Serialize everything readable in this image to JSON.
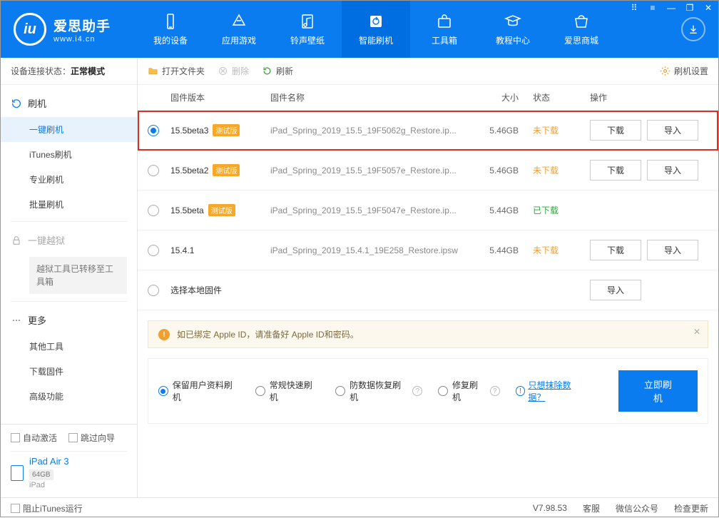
{
  "app": {
    "name": "爱思助手",
    "url": "www.i4.cn"
  },
  "nav": {
    "items": [
      {
        "label": "我的设备"
      },
      {
        "label": "应用游戏"
      },
      {
        "label": "铃声壁纸"
      },
      {
        "label": "智能刷机"
      },
      {
        "label": "工具箱"
      },
      {
        "label": "教程中心"
      },
      {
        "label": "爱思商城"
      }
    ],
    "active_index": 3
  },
  "sidebar": {
    "status_label": "设备连接状态：",
    "status_value": "正常模式",
    "flash": {
      "header": "刷机",
      "items": [
        "一键刷机",
        "iTunes刷机",
        "专业刷机",
        "批量刷机"
      ],
      "active_index": 0
    },
    "jailbreak": {
      "header": "一键越狱",
      "note": "越狱工具已转移至工具箱"
    },
    "more": {
      "header": "更多",
      "items": [
        "其他工具",
        "下载固件",
        "高级功能"
      ]
    },
    "checks": {
      "auto_activate": "自动激活",
      "skip_guide": "跳过向导"
    },
    "device": {
      "name": "iPad Air 3",
      "storage": "64GB",
      "type": "iPad"
    }
  },
  "toolbar": {
    "open_folder": "打开文件夹",
    "delete": "删除",
    "refresh": "刷新",
    "settings": "刷机设置"
  },
  "table": {
    "headers": {
      "version": "固件版本",
      "name": "固件名称",
      "size": "大小",
      "status": "状态",
      "ops": "操作"
    },
    "beta_tag": "测试版",
    "status_labels": {
      "not_downloaded": "未下载",
      "downloaded": "已下载"
    },
    "btn_download": "下载",
    "btn_import": "导入",
    "rows": [
      {
        "version": "15.5beta3",
        "beta": true,
        "name": "iPad_Spring_2019_15.5_19F5062g_Restore.ip...",
        "size": "5.46GB",
        "status": "not_downloaded",
        "selected": true,
        "highlight": true,
        "ops": [
          "download",
          "import"
        ]
      },
      {
        "version": "15.5beta2",
        "beta": true,
        "name": "iPad_Spring_2019_15.5_19F5057e_Restore.ip...",
        "size": "5.46GB",
        "status": "not_downloaded",
        "ops": [
          "download",
          "import"
        ]
      },
      {
        "version": "15.5beta",
        "beta": true,
        "name": "iPad_Spring_2019_15.5_19F5047e_Restore.ip...",
        "size": "5.44GB",
        "status": "downloaded",
        "ops": []
      },
      {
        "version": "15.4.1",
        "beta": false,
        "name": "iPad_Spring_2019_15.4.1_19E258_Restore.ipsw",
        "size": "5.44GB",
        "status": "not_downloaded",
        "ops": [
          "download",
          "import"
        ]
      }
    ],
    "local_row": "选择本地固件"
  },
  "notice": "如已绑定 Apple ID，请准备好 Apple ID和密码。",
  "options": {
    "items": [
      "保留用户资料刷机",
      "常规快速刷机",
      "防数据恢复刷机",
      "修复刷机"
    ],
    "selected_index": 0,
    "erase_link": "只想抹除数据？",
    "flash_btn": "立即刷机"
  },
  "footer": {
    "block_itunes": "阻止iTunes运行",
    "version": "V7.98.53",
    "support": "客服",
    "wechat": "微信公众号",
    "update": "检查更新"
  }
}
